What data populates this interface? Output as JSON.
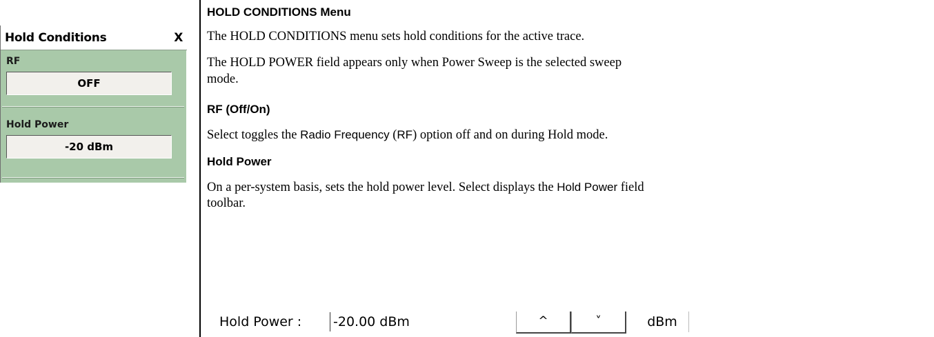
{
  "menu": {
    "title": "Hold Conditions",
    "close_label": "X",
    "rf": {
      "label": "RF",
      "value": "OFF"
    },
    "hold_power": {
      "label": "Hold Power",
      "value": "-20  dBm"
    }
  },
  "doc": {
    "heading_menu": "HOLD CONDITIONS Menu",
    "para_intro": "The HOLD CONDITIONS menu sets hold conditions for the active trace.",
    "para_power_1": "The HOLD POWER field appears only when Power Sweep is the selected sweep",
    "para_power_2": "mode.",
    "heading_rf": "RF (Off/On)",
    "rf_text_a": "Select toggles the ",
    "rf_text_b": "Radio Frequency",
    "rf_text_c": " (",
    "rf_text_d": "RF",
    "rf_text_e": ") option off and on during Hold mode.",
    "heading_hold": "Hold Power",
    "hold_text_1a": "On a per-system basis, sets the hold power level. Select displays the ",
    "hold_text_1b": "Hold Power",
    "hold_text_1c": " field",
    "hold_text_2": "toolbar."
  },
  "toolbar": {
    "label": "Hold Power :",
    "value": "-20.00  dBm",
    "up_label": "^",
    "down_label": "˅",
    "unit_label": "dBm"
  }
}
